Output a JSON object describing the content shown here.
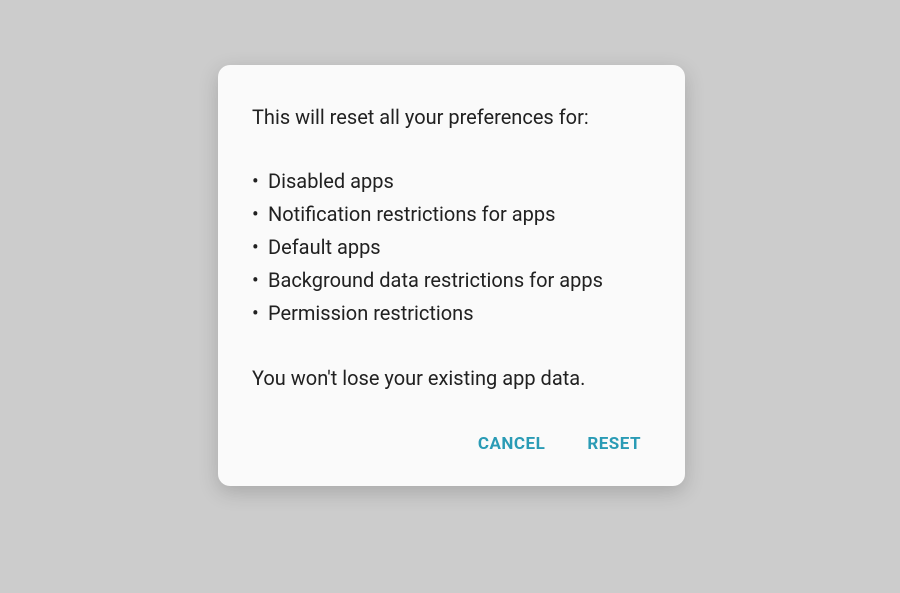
{
  "dialog": {
    "intro": "This will reset all your preferences for:",
    "bullets": [
      "Disabled apps",
      "Notification restrictions for apps",
      "Default apps",
      "Background data restrictions for apps",
      "Permission restrictions"
    ],
    "footer": "You won't lose your existing app data.",
    "cancel_label": "CANCEL",
    "reset_label": "RESET"
  }
}
